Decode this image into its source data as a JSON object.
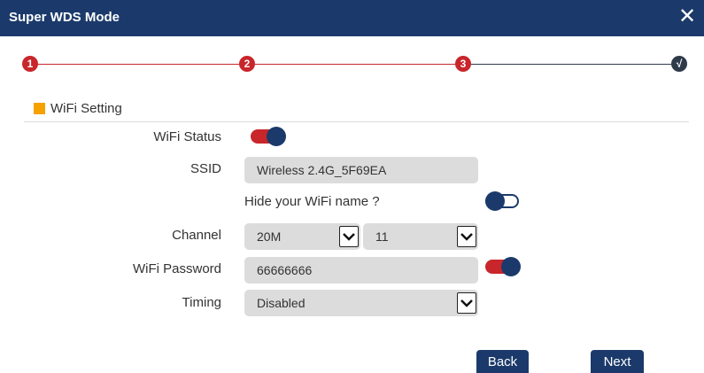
{
  "title": "Super WDS Mode",
  "close_glyph": "✕",
  "steps": [
    {
      "label": "1",
      "state": "done"
    },
    {
      "label": "2",
      "state": "done"
    },
    {
      "label": "3",
      "state": "current"
    },
    {
      "label": "√",
      "state": "pending"
    }
  ],
  "section_title": "WiFi Setting",
  "form": {
    "wifi_status_label": "WiFi Status",
    "wifi_status_on": true,
    "ssid_label": "SSID",
    "ssid_value": "Wireless 2.4G_5F69EA",
    "hide_label": "Hide your WiFi name ?",
    "hide_on": false,
    "channel_label": "Channel",
    "bandwidth_value": "20M",
    "channel_value": "11",
    "password_label": "WiFi Password",
    "password_value": "66666666",
    "password_visible_on": true,
    "timing_label": "Timing",
    "timing_value": "Disabled"
  },
  "buttons": {
    "back": "Back",
    "next": "Next"
  },
  "colors": {
    "header": "#1b3a6b",
    "accent_red": "#c8262b",
    "section_marker": "#f5a100",
    "field_bg": "#dcdcdc"
  },
  "icons": {
    "close": "close-icon",
    "select_arrow": "chevron-down-icon"
  }
}
